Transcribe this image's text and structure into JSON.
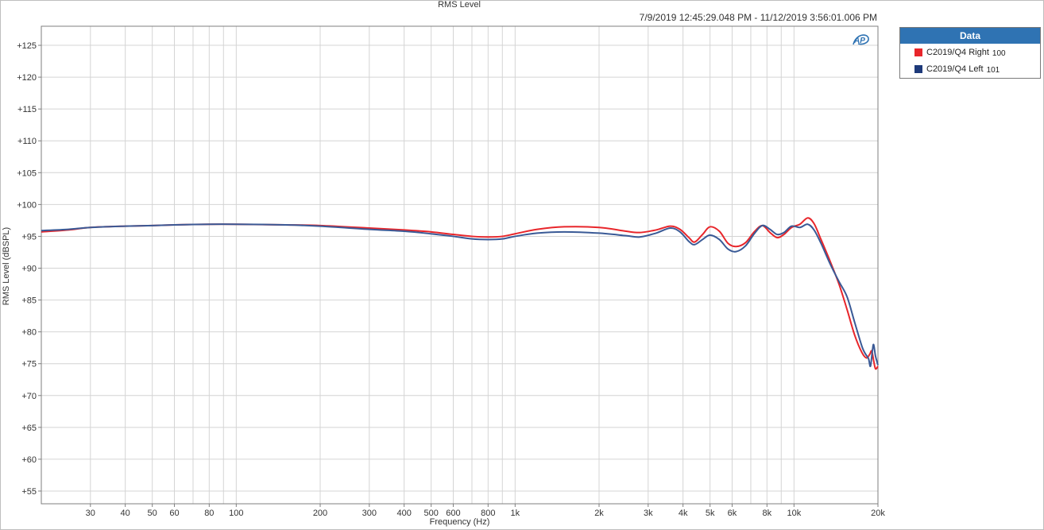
{
  "header": {
    "title": "RMS Level",
    "date_range": "7/9/2019 12:45:29.048 PM - 11/12/2019 3:56:01.006 PM"
  },
  "logo_text": "AP",
  "legend": {
    "title": "Data",
    "items": [
      {
        "name": "C2019/Q4 Right",
        "id": "100",
        "color": "#e8262b"
      },
      {
        "name": "C2019/Q4 Left",
        "id": "101",
        "color": "#1e3a7a"
      }
    ]
  },
  "colors": {
    "grid": "#d4d4d4",
    "axis": "#7f7f7f",
    "right": "#e8262b",
    "left": "#3a5a96",
    "legend_header": "#2f73b3"
  },
  "chart_data": {
    "type": "line",
    "title": "RMS Level",
    "xlabel": "Frequency (Hz)",
    "ylabel": "RMS Level (dBSPL)",
    "x_scale": "log",
    "xlim": [
      20,
      20000
    ],
    "ylim": [
      53,
      128
    ],
    "grid": true,
    "legend_position": "right-top",
    "x_ticks": [
      {
        "v": 30,
        "label": "30"
      },
      {
        "v": 40,
        "label": "40"
      },
      {
        "v": 50,
        "label": "50"
      },
      {
        "v": 60,
        "label": "60"
      },
      {
        "v": 80,
        "label": "80"
      },
      {
        "v": 100,
        "label": "100"
      },
      {
        "v": 200,
        "label": "200"
      },
      {
        "v": 300,
        "label": "300"
      },
      {
        "v": 400,
        "label": "400"
      },
      {
        "v": 500,
        "label": "500"
      },
      {
        "v": 600,
        "label": "600"
      },
      {
        "v": 800,
        "label": "800"
      },
      {
        "v": 1000,
        "label": "1k"
      },
      {
        "v": 2000,
        "label": "2k"
      },
      {
        "v": 3000,
        "label": "3k"
      },
      {
        "v": 4000,
        "label": "4k"
      },
      {
        "v": 5000,
        "label": "5k"
      },
      {
        "v": 6000,
        "label": "6k"
      },
      {
        "v": 8000,
        "label": "8k"
      },
      {
        "v": 10000,
        "label": "10k"
      },
      {
        "v": 20000,
        "label": "20k"
      }
    ],
    "y_ticks": [
      {
        "v": 55,
        "label": "+55"
      },
      {
        "v": 60,
        "label": "+60"
      },
      {
        "v": 65,
        "label": "+65"
      },
      {
        "v": 70,
        "label": "+70"
      },
      {
        "v": 75,
        "label": "+75"
      },
      {
        "v": 80,
        "label": "+80"
      },
      {
        "v": 85,
        "label": "+85"
      },
      {
        "v": 90,
        "label": "+90"
      },
      {
        "v": 95,
        "label": "+95"
      },
      {
        "v": 100,
        "label": "+100"
      },
      {
        "v": 105,
        "label": "+105"
      },
      {
        "v": 110,
        "label": "+110"
      },
      {
        "v": 115,
        "label": "+115"
      },
      {
        "v": 120,
        "label": "+120"
      },
      {
        "v": 125,
        "label": "+125"
      }
    ],
    "series": [
      {
        "name": "C2019/Q4 Right 100",
        "color": "#e8262b",
        "points": [
          [
            20,
            95.7
          ],
          [
            25,
            96.0
          ],
          [
            30,
            96.4
          ],
          [
            40,
            96.6
          ],
          [
            50,
            96.7
          ],
          [
            60,
            96.8
          ],
          [
            80,
            96.9
          ],
          [
            100,
            96.9
          ],
          [
            150,
            96.8
          ],
          [
            200,
            96.7
          ],
          [
            300,
            96.3
          ],
          [
            400,
            96.0
          ],
          [
            500,
            95.7
          ],
          [
            600,
            95.3
          ],
          [
            700,
            95.0
          ],
          [
            800,
            94.9
          ],
          [
            900,
            95.0
          ],
          [
            1000,
            95.4
          ],
          [
            1200,
            96.1
          ],
          [
            1500,
            96.5
          ],
          [
            2000,
            96.4
          ],
          [
            2500,
            95.8
          ],
          [
            2800,
            95.6
          ],
          [
            3200,
            96.0
          ],
          [
            3600,
            96.6
          ],
          [
            3900,
            96.1
          ],
          [
            4200,
            94.8
          ],
          [
            4400,
            94.1
          ],
          [
            4700,
            95.3
          ],
          [
            5000,
            96.5
          ],
          [
            5400,
            95.8
          ],
          [
            5800,
            93.9
          ],
          [
            6200,
            93.4
          ],
          [
            6700,
            94.0
          ],
          [
            7200,
            95.7
          ],
          [
            7700,
            96.7
          ],
          [
            8200,
            95.6
          ],
          [
            8700,
            94.8
          ],
          [
            9200,
            95.3
          ],
          [
            9800,
            96.4
          ],
          [
            10500,
            96.9
          ],
          [
            11200,
            97.9
          ],
          [
            11800,
            97.0
          ],
          [
            12500,
            94.5
          ],
          [
            13500,
            91.0
          ],
          [
            14500,
            87.5
          ],
          [
            15500,
            83.5
          ],
          [
            16500,
            79.5
          ],
          [
            17500,
            76.8
          ],
          [
            18200,
            75.9
          ],
          [
            18700,
            76.5
          ],
          [
            19000,
            77.0
          ],
          [
            19300,
            75.5
          ],
          [
            19600,
            74.2
          ],
          [
            20000,
            74.6
          ]
        ]
      },
      {
        "name": "C2019/Q4 Left 101",
        "color": "#3a5a96",
        "points": [
          [
            20,
            95.9
          ],
          [
            25,
            96.1
          ],
          [
            30,
            96.4
          ],
          [
            40,
            96.6
          ],
          [
            50,
            96.7
          ],
          [
            60,
            96.8
          ],
          [
            80,
            96.9
          ],
          [
            100,
            96.9
          ],
          [
            150,
            96.8
          ],
          [
            200,
            96.6
          ],
          [
            300,
            96.1
          ],
          [
            400,
            95.8
          ],
          [
            500,
            95.4
          ],
          [
            600,
            95.0
          ],
          [
            700,
            94.6
          ],
          [
            800,
            94.5
          ],
          [
            900,
            94.6
          ],
          [
            1000,
            95.0
          ],
          [
            1200,
            95.5
          ],
          [
            1500,
            95.7
          ],
          [
            2000,
            95.5
          ],
          [
            2500,
            95.1
          ],
          [
            2800,
            94.9
          ],
          [
            3200,
            95.5
          ],
          [
            3600,
            96.3
          ],
          [
            3900,
            95.7
          ],
          [
            4200,
            94.2
          ],
          [
            4400,
            93.7
          ],
          [
            4700,
            94.5
          ],
          [
            5000,
            95.2
          ],
          [
            5400,
            94.5
          ],
          [
            5800,
            93.0
          ],
          [
            6200,
            92.6
          ],
          [
            6700,
            93.5
          ],
          [
            7200,
            95.4
          ],
          [
            7700,
            96.7
          ],
          [
            8200,
            96.1
          ],
          [
            8700,
            95.3
          ],
          [
            9200,
            95.6
          ],
          [
            9800,
            96.6
          ],
          [
            10500,
            96.4
          ],
          [
            11200,
            96.9
          ],
          [
            11800,
            96.0
          ],
          [
            12500,
            93.9
          ],
          [
            13500,
            90.6
          ],
          [
            14500,
            87.9
          ],
          [
            15500,
            85.5
          ],
          [
            16500,
            81.5
          ],
          [
            17500,
            77.8
          ],
          [
            18000,
            76.6
          ],
          [
            18500,
            75.8
          ],
          [
            18800,
            74.6
          ],
          [
            19100,
            77.0
          ],
          [
            19300,
            78.0
          ],
          [
            19600,
            76.2
          ],
          [
            20000,
            74.8
          ]
        ]
      }
    ]
  }
}
